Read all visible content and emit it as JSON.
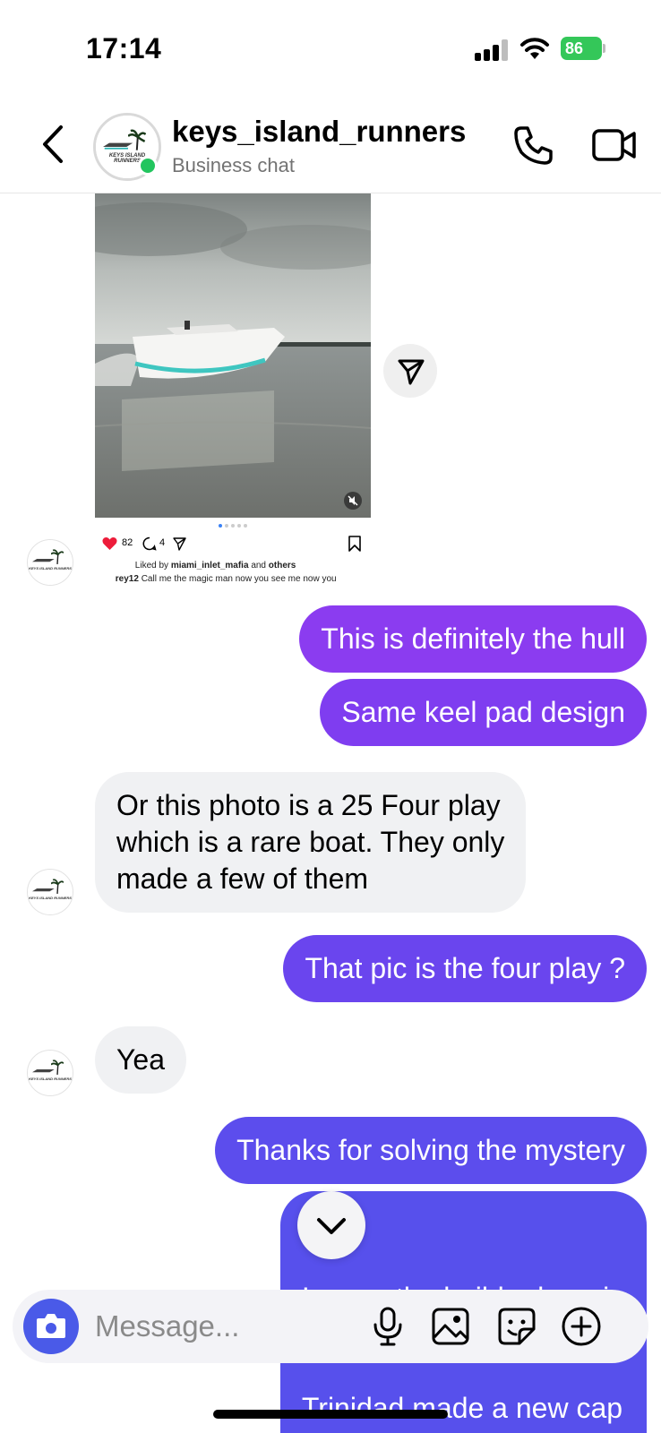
{
  "status_bar": {
    "time": "17:14",
    "battery": "86"
  },
  "header": {
    "title": "keys_island_runners",
    "subtitle": "Business chat"
  },
  "shared_post": {
    "like_count": "82",
    "comment_count": "4",
    "liked_by_prefix": "Liked by",
    "liked_by_user": "miami_inlet_mafia",
    "liked_by_and": "and",
    "liked_by_others": "others",
    "caption_user": "rey12",
    "caption_text": "Call me the magic man now you see me now you",
    "carousel_pages": 5,
    "carousel_active": 1
  },
  "avatar_logo_text": "KEYS ISLAND RUNNERS",
  "messages": [
    {
      "id": 1,
      "direction": "out",
      "lines": [
        "This is definitely the hull"
      ],
      "color": "#8b3cf0"
    },
    {
      "id": 2,
      "direction": "out",
      "lines": [
        "Same keel pad design"
      ],
      "color": "#7f3df0"
    },
    {
      "id": 3,
      "direction": "in",
      "lines": [
        "Or this photo is a 25 Four play",
        "which is a rare boat. They only",
        "made a few of them"
      ]
    },
    {
      "id": 4,
      "direction": "out",
      "lines": [
        "That pic is the four play ?"
      ],
      "color": "#6a45ee"
    },
    {
      "id": 5,
      "direction": "in",
      "lines": [
        "Yea"
      ]
    },
    {
      "id": 6,
      "direction": "out",
      "lines": [
        "Thanks for solving the mystery"
      ],
      "color": "#5c4ded"
    },
    {
      "id": 7,
      "direction": "out",
      "lines": [
        "I        y the builder here in",
        "Trinidad made a new cap"
      ],
      "color": "#5750ec"
    }
  ],
  "composer": {
    "placeholder": "Message..."
  },
  "colors": {
    "accent_blue": "#4a5ae8",
    "online_green": "#22c55e",
    "incoming_bubble": "#f0f1f3",
    "heart": "#ed1c3a"
  },
  "icons": [
    "back-chevron-icon",
    "phone-icon",
    "video-camera-icon",
    "send-icon",
    "mute-icon",
    "heart-icon",
    "comment-icon",
    "bookmark-icon",
    "chevron-down-icon",
    "camera-icon",
    "microphone-icon",
    "gallery-icon",
    "sticker-icon",
    "plus-circle-icon"
  ]
}
